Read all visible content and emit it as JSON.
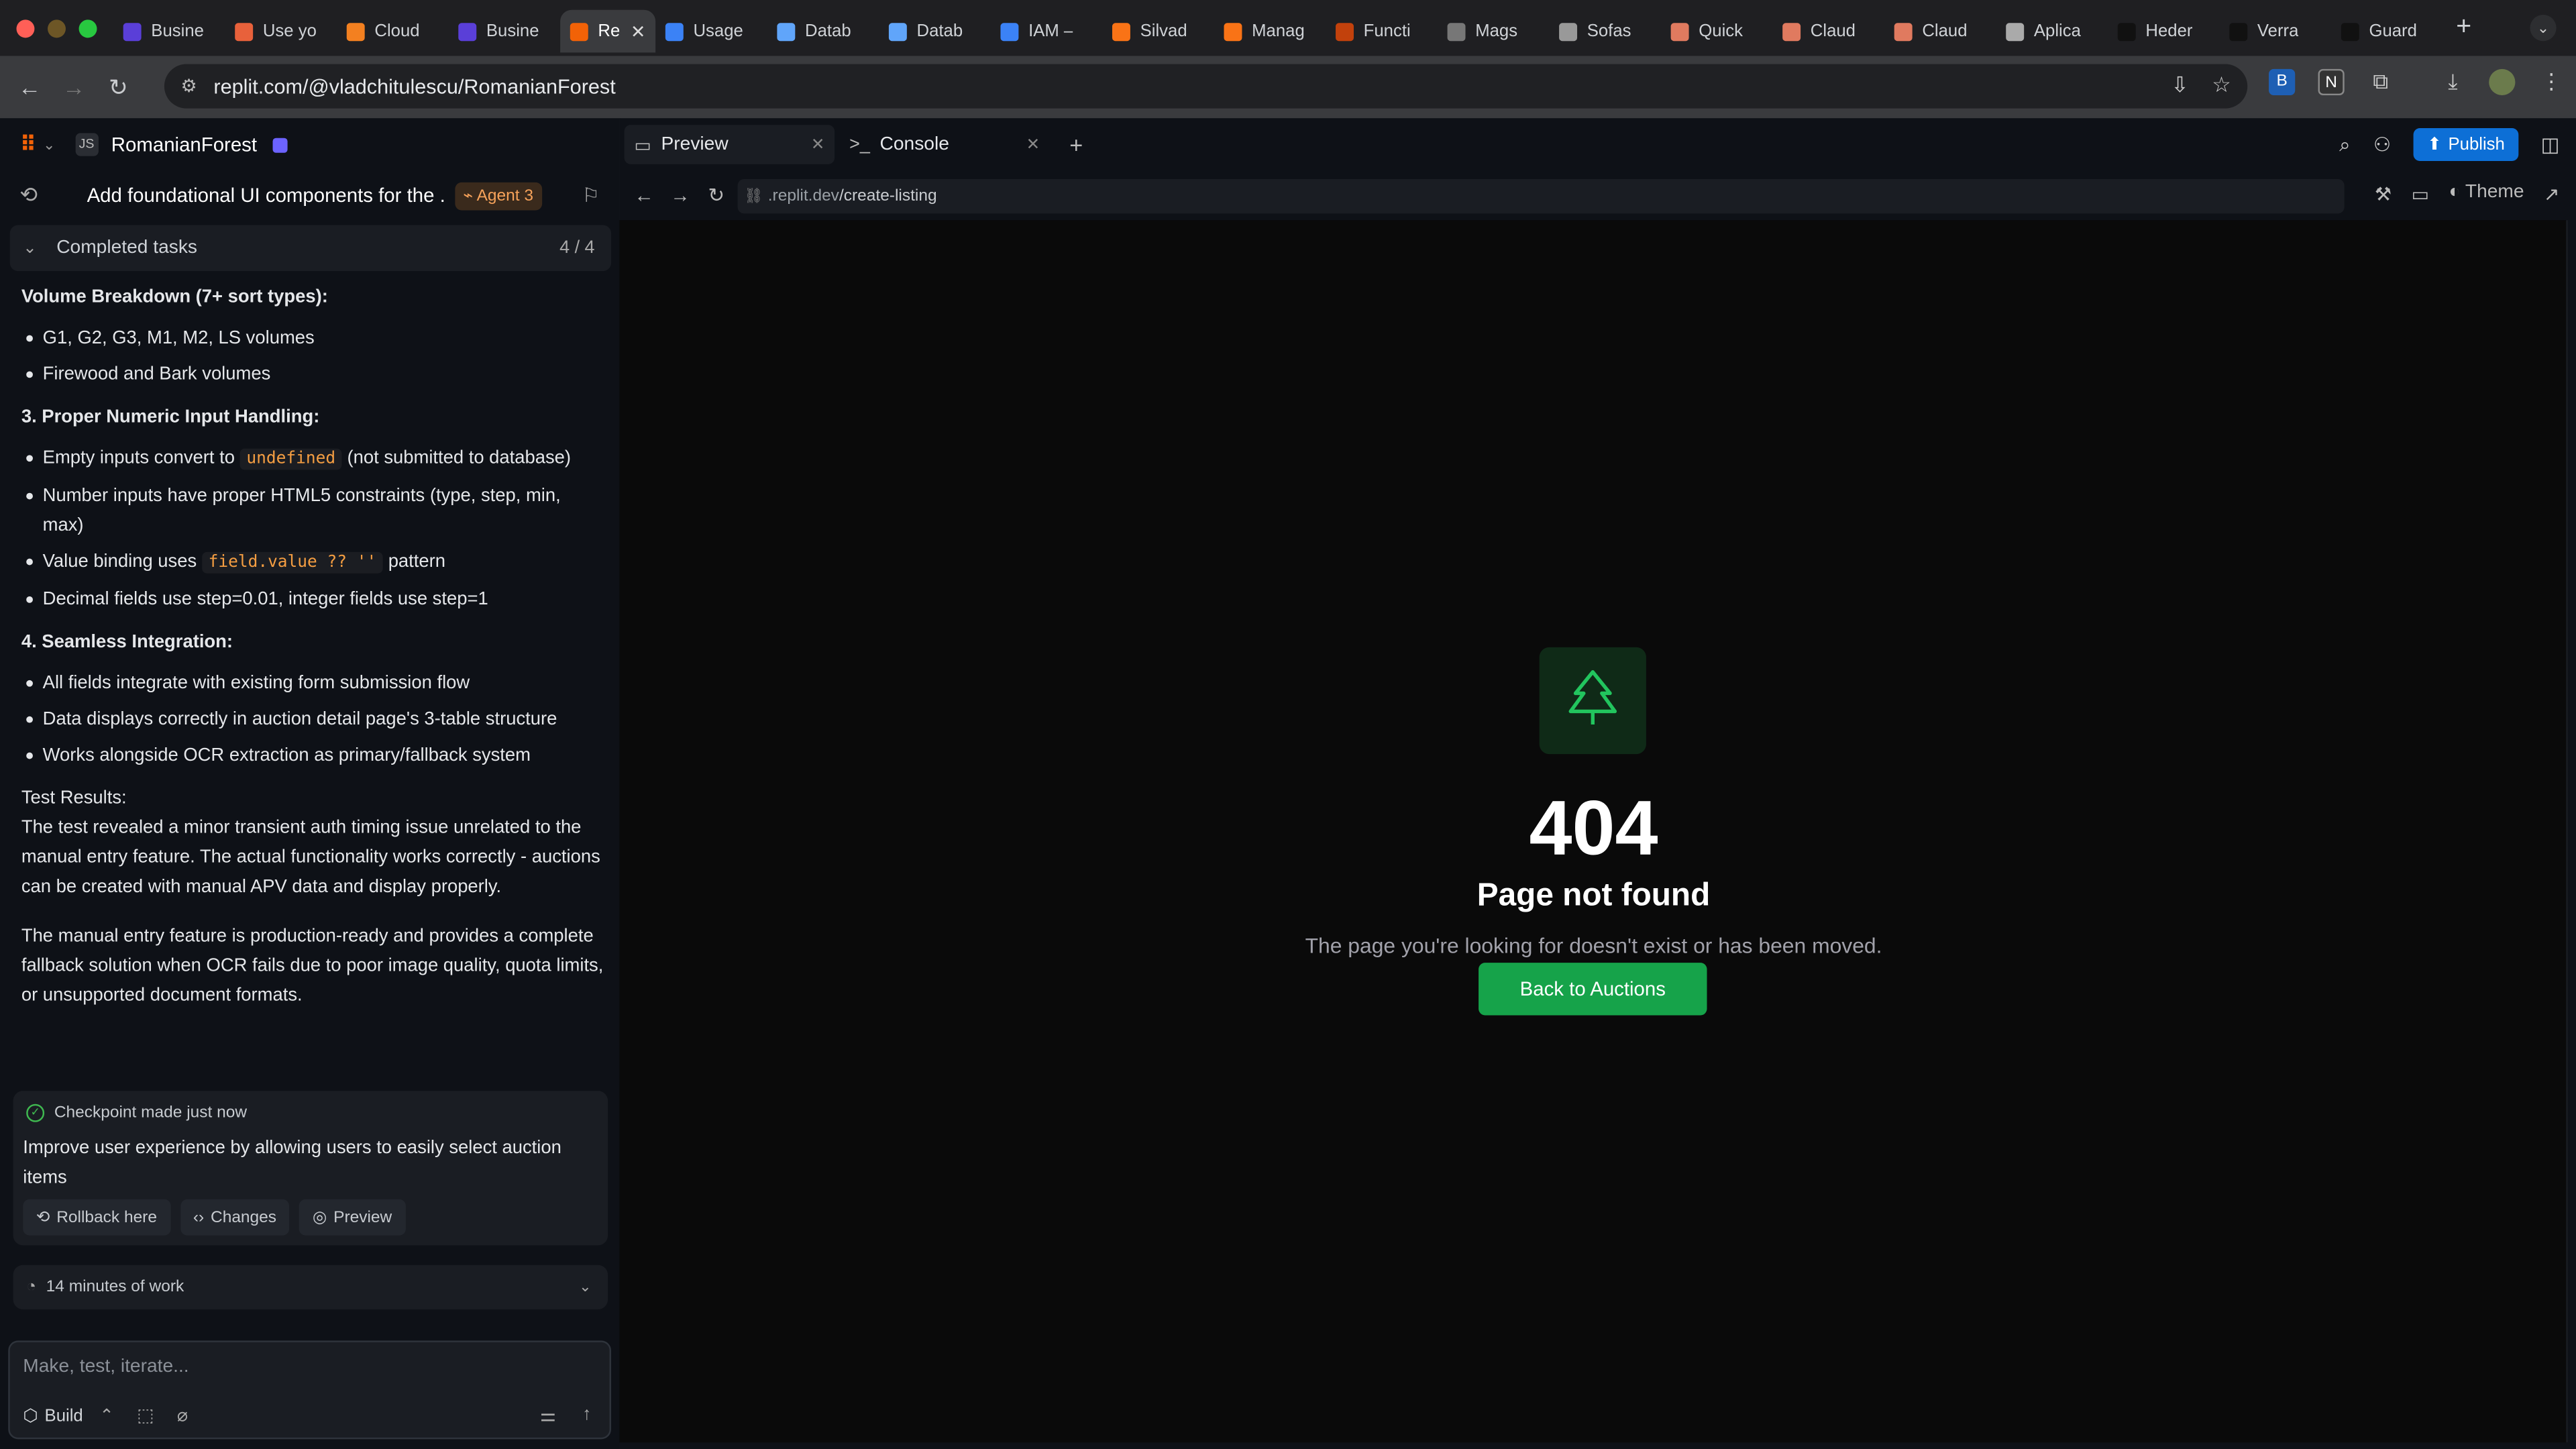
{
  "browser": {
    "tabs": [
      {
        "title": "Busine",
        "color": "#5a3fd8"
      },
      {
        "title": "Use yo",
        "color": "#e8613b"
      },
      {
        "title": "Cloud",
        "color": "#f38020"
      },
      {
        "title": "Busine",
        "color": "#5a3fd8"
      },
      {
        "title": "Re",
        "color": "#f26207",
        "active": true
      },
      {
        "title": "Usage",
        "color": "#3b82f6"
      },
      {
        "title": "Datab",
        "color": "#60a5fa"
      },
      {
        "title": "Datab",
        "color": "#60a5fa"
      },
      {
        "title": "IAM –",
        "color": "#3b82f6"
      },
      {
        "title": "Silvad",
        "color": "#f97316"
      },
      {
        "title": "Manag",
        "color": "#f97316"
      },
      {
        "title": "Functi",
        "color": "#c2410c"
      },
      {
        "title": "Mags",
        "color": "#777777"
      },
      {
        "title": "Sofas",
        "color": "#999999"
      },
      {
        "title": "Quick",
        "color": "#e07a5f"
      },
      {
        "title": "Claud",
        "color": "#e07a5f"
      },
      {
        "title": "Claud",
        "color": "#e07a5f"
      },
      {
        "title": "Aplica",
        "color": "#aaaaaa"
      },
      {
        "title": "Heder",
        "color": "#111111"
      },
      {
        "title": "Verra",
        "color": "#111111"
      },
      {
        "title": "Guard",
        "color": "#111111"
      }
    ],
    "url": "replit.com/@vladchitulescu/RomanianForest"
  },
  "workspace": {
    "project_name": "RomanianForest",
    "thread_title": "Add foundational UI components for the ...",
    "agent_badge": "Agent 3",
    "completed_tasks_label": "Completed tasks",
    "completed_tasks_count": "4 / 4"
  },
  "message": {
    "h_volume": "Volume Breakdown (7+ sort types):",
    "volume_items": [
      "G1, G2, G3, M1, M2, LS volumes",
      "Firewood and Bark volumes"
    ],
    "h_numeric": "3. Proper Numeric Input Handling:",
    "numeric_1_pre": "Empty inputs convert to ",
    "numeric_1_code": "undefined",
    "numeric_1_post": " (not submitted to database)",
    "numeric_2": "Number inputs have proper HTML5 constraints (type, step, min, max)",
    "numeric_3_pre": "Value binding uses ",
    "numeric_3_code": "field.value ?? ''",
    "numeric_3_post": " pattern",
    "numeric_4": "Decimal fields use step=0.01, integer fields use step=1",
    "h_integration": "4. Seamless Integration:",
    "integration_items": [
      "All fields integrate with existing form submission flow",
      "Data displays correctly in auction detail page's 3-table structure",
      "Works alongside OCR extraction as primary/fallback system"
    ],
    "test_results_label": "Test Results:",
    "test_results_text": "The test revealed a minor transient auth timing issue unrelated to the manual entry feature. The actual functionality works correctly - auctions can be created with manual APV data and display properly.",
    "conclusion": "The manual entry feature is production-ready and provides a complete fallback solution when OCR fails due to poor image quality, quota limits, or unsupported document formats."
  },
  "checkpoint": {
    "label": "Checkpoint made just now",
    "description": "Improve user experience by allowing users to easily select auction items",
    "rollback": "Rollback here",
    "changes": "Changes",
    "preview": "Preview"
  },
  "work_summary": "14 minutes of work",
  "composer": {
    "placeholder": "Make, test, iterate...",
    "mode": "Build"
  },
  "right": {
    "tab_preview": "Preview",
    "tab_console": "Console",
    "publish": "Publish",
    "url_prefix": ".replit.dev",
    "url_path": "/create-listing",
    "theme": "Theme"
  },
  "notfound": {
    "code": "404",
    "heading": "Page not found",
    "text": "The page you're looking for doesn't exist or has been moved.",
    "button": "Back to Auctions"
  }
}
